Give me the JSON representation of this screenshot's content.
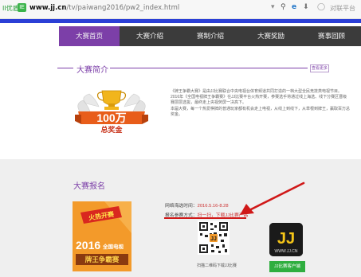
{
  "browser": {
    "bookmark_label": "IE",
    "url_host": "www.jj.cn",
    "url_path": "/tv/paiwang2016/pw2_index.html",
    "secure_label": "II优盾",
    "dropdown_glyph": "▾",
    "search_glyph": "⚲",
    "ie_glyph": "e",
    "download_glyph": "⬇",
    "extra_glyph": "◯",
    "right_label": "对联平台"
  },
  "nav": {
    "items": [
      {
        "label": "大赛首页",
        "active": true
      },
      {
        "label": "大赛介绍",
        "active": false
      },
      {
        "label": "赛制介绍",
        "active": false
      },
      {
        "label": "大赛奖励",
        "active": false
      },
      {
        "label": "赛事回顾",
        "active": false
      }
    ]
  },
  "intro": {
    "title": "大赛简介",
    "more_button": "查看更多",
    "award_amount": "100万",
    "award_label": "总奖金",
    "paragraphs": [
      "《牌王争霸大赛》是由JJ比赛联合中央电视台体育频道共同打造的一档大型全民竞技类电视节目。",
      "2016年《全国电视牌王争霸赛》在JJ比赛平台火热开赛，参赛选手将通过线上海选、线下分赛区晋级赛层层选拔，最终走上央视荧屏一决高下。",
      "本届大赛，每一个热爱棋牌的普通玩家都有机会走上电视，从线上到线下，从草根到牌王，赢取百万总奖金。"
    ]
  },
  "registration": {
    "title": "大赛报名",
    "poster_banner": "火热开赛",
    "poster_year": "2016",
    "poster_line1": "全国电视",
    "poster_line2": "牌王争霸赛",
    "time_label": "网络海选时间：",
    "time_value": "2016.5.16-8.28",
    "method_label": "报名参赛方式：",
    "method_value": "扫一扫，下载JJ比赛产品",
    "qr_caption": "扫描二维码下载JJ比赛",
    "app_logo_text": "JJ",
    "app_logo_domain": "WWW.JJ.CN",
    "app_button": "JJ比赛客户端"
  },
  "colors": {
    "accent_purple": "#7c3fa8",
    "nav_dark": "#3b3b3b",
    "arrow_red": "#d01818",
    "poster_orange": "#f39a2a",
    "app_green": "#2fae3f"
  }
}
